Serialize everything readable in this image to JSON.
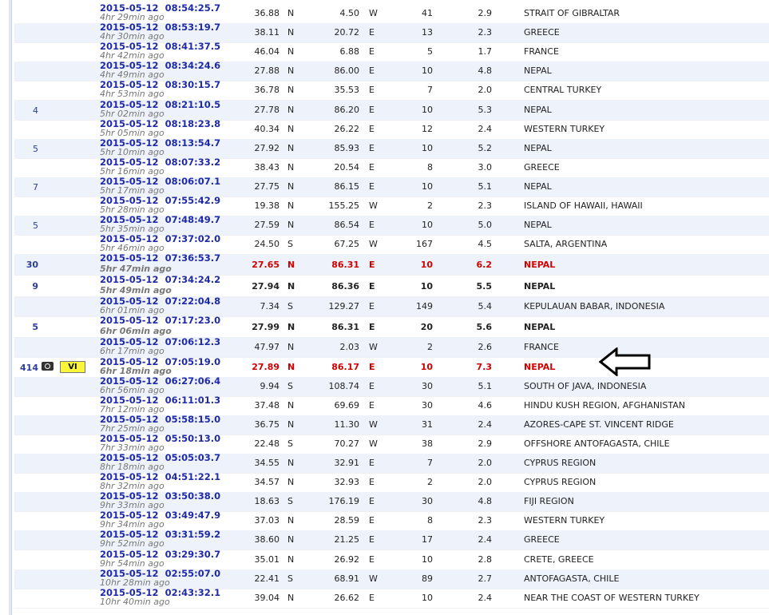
{
  "rows": [
    {
      "felt": "",
      "date": "2015-05-12",
      "time": "08:54:25.7",
      "ago": "4hr 29min ago",
      "lat": "36.88",
      "ns": "N",
      "lon": "4.50",
      "ew": "W",
      "depth": "41",
      "mag": "2.9",
      "region": "STRAIT OF GIBRALTAR",
      "style": ""
    },
    {
      "felt": "",
      "date": "2015-05-12",
      "time": "08:53:19.7",
      "ago": "4hr 30min ago",
      "lat": "38.11",
      "ns": "N",
      "lon": "20.72",
      "ew": "E",
      "depth": "13",
      "mag": "2.3",
      "region": "GREECE",
      "style": ""
    },
    {
      "felt": "",
      "date": "2015-05-12",
      "time": "08:41:37.5",
      "ago": "4hr 42min ago",
      "lat": "46.04",
      "ns": "N",
      "lon": "6.88",
      "ew": "E",
      "depth": "5",
      "mag": "1.7",
      "region": "FRANCE",
      "style": ""
    },
    {
      "felt": "",
      "date": "2015-05-12",
      "time": "08:34:24.6",
      "ago": "4hr 49min ago",
      "lat": "27.88",
      "ns": "N",
      "lon": "86.00",
      "ew": "E",
      "depth": "10",
      "mag": "4.8",
      "region": "NEPAL",
      "style": ""
    },
    {
      "felt": "",
      "date": "2015-05-12",
      "time": "08:30:15.7",
      "ago": "4hr 53min ago",
      "lat": "36.78",
      "ns": "N",
      "lon": "35.53",
      "ew": "E",
      "depth": "7",
      "mag": "2.0",
      "region": "CENTRAL TURKEY",
      "style": ""
    },
    {
      "felt": "4",
      "date": "2015-05-12",
      "time": "08:21:10.5",
      "ago": "5hr 02min ago",
      "lat": "27.78",
      "ns": "N",
      "lon": "86.20",
      "ew": "E",
      "depth": "10",
      "mag": "5.3",
      "region": "NEPAL",
      "style": ""
    },
    {
      "felt": "",
      "date": "2015-05-12",
      "time": "08:18:23.8",
      "ago": "5hr 05min ago",
      "lat": "40.34",
      "ns": "N",
      "lon": "26.22",
      "ew": "E",
      "depth": "12",
      "mag": "2.4",
      "region": "WESTERN TURKEY",
      "style": ""
    },
    {
      "felt": "5",
      "date": "2015-05-12",
      "time": "08:13:54.7",
      "ago": "5hr 10min ago",
      "lat": "27.92",
      "ns": "N",
      "lon": "85.93",
      "ew": "E",
      "depth": "10",
      "mag": "5.2",
      "region": "NEPAL",
      "style": ""
    },
    {
      "felt": "",
      "date": "2015-05-12",
      "time": "08:07:33.2",
      "ago": "5hr 16min ago",
      "lat": "38.43",
      "ns": "N",
      "lon": "20.54",
      "ew": "E",
      "depth": "8",
      "mag": "3.0",
      "region": "GREECE",
      "style": ""
    },
    {
      "felt": "7",
      "date": "2015-05-12",
      "time": "08:06:07.1",
      "ago": "5hr 17min ago",
      "lat": "27.75",
      "ns": "N",
      "lon": "86.15",
      "ew": "E",
      "depth": "10",
      "mag": "5.1",
      "region": "NEPAL",
      "style": ""
    },
    {
      "felt": "",
      "date": "2015-05-12",
      "time": "07:55:42.9",
      "ago": "5hr 28min ago",
      "lat": "19.38",
      "ns": "N",
      "lon": "155.25",
      "ew": "W",
      "depth": "2",
      "mag": "2.3",
      "region": "ISLAND OF HAWAII, HAWAII",
      "style": ""
    },
    {
      "felt": "5",
      "date": "2015-05-12",
      "time": "07:48:49.7",
      "ago": "5hr 35min ago",
      "lat": "27.59",
      "ns": "N",
      "lon": "86.54",
      "ew": "E",
      "depth": "10",
      "mag": "5.0",
      "region": "NEPAL",
      "style": ""
    },
    {
      "felt": "",
      "date": "2015-05-12",
      "time": "07:37:02.0",
      "ago": "5hr 46min ago",
      "lat": "24.50",
      "ns": "S",
      "lon": "67.25",
      "ew": "W",
      "depth": "167",
      "mag": "4.5",
      "region": "SALTA, ARGENTINA",
      "style": ""
    },
    {
      "felt": "30",
      "date": "2015-05-12",
      "time": "07:36:53.7",
      "ago": "5hr 47min ago",
      "lat": "27.65",
      "ns": "N",
      "lon": "86.31",
      "ew": "E",
      "depth": "10",
      "mag": "6.2",
      "region": "NEPAL",
      "style": "hl"
    },
    {
      "felt": "9",
      "date": "2015-05-12",
      "time": "07:34:24.2",
      "ago": "5hr 49min ago",
      "lat": "27.94",
      "ns": "N",
      "lon": "86.36",
      "ew": "E",
      "depth": "10",
      "mag": "5.5",
      "region": "NEPAL",
      "style": "bold"
    },
    {
      "felt": "",
      "date": "2015-05-12",
      "time": "07:22:04.8",
      "ago": "6hr 01min ago",
      "lat": "7.34",
      "ns": "S",
      "lon": "129.27",
      "ew": "E",
      "depth": "149",
      "mag": "5.4",
      "region": "KEPULAUAN BABAR, INDONESIA",
      "style": ""
    },
    {
      "felt": "5",
      "date": "2015-05-12",
      "time": "07:17:23.0",
      "ago": "6hr 06min ago",
      "lat": "27.99",
      "ns": "N",
      "lon": "86.31",
      "ew": "E",
      "depth": "20",
      "mag": "5.6",
      "region": "NEPAL",
      "style": "bold"
    },
    {
      "felt": "",
      "date": "2015-05-12",
      "time": "07:06:12.3",
      "ago": "6hr 17min ago",
      "lat": "47.97",
      "ns": "N",
      "lon": "2.03",
      "ew": "W",
      "depth": "2",
      "mag": "2.6",
      "region": "FRANCE",
      "style": ""
    },
    {
      "felt": "414",
      "date": "2015-05-12",
      "time": "07:05:19.0",
      "ago": "6hr 18min ago",
      "lat": "27.89",
      "ns": "N",
      "lon": "86.17",
      "ew": "E",
      "depth": "10",
      "mag": "7.3",
      "region": "NEPAL",
      "style": "hl",
      "intensity": "VI"
    },
    {
      "felt": "",
      "date": "2015-05-12",
      "time": "06:27:06.4",
      "ago": "6hr 56min ago",
      "lat": "9.94",
      "ns": "S",
      "lon": "108.74",
      "ew": "E",
      "depth": "30",
      "mag": "5.1",
      "region": "SOUTH OF JAVA, INDONESIA",
      "style": ""
    },
    {
      "felt": "",
      "date": "2015-05-12",
      "time": "06:11:01.3",
      "ago": "7hr 12min ago",
      "lat": "37.48",
      "ns": "N",
      "lon": "69.69",
      "ew": "E",
      "depth": "30",
      "mag": "4.6",
      "region": "HINDU KUSH REGION, AFGHANISTAN",
      "style": ""
    },
    {
      "felt": "",
      "date": "2015-05-12",
      "time": "05:58:15.0",
      "ago": "7hr 25min ago",
      "lat": "36.75",
      "ns": "N",
      "lon": "11.30",
      "ew": "W",
      "depth": "31",
      "mag": "2.4",
      "region": "AZORES-CAPE ST. VINCENT RIDGE",
      "style": ""
    },
    {
      "felt": "",
      "date": "2015-05-12",
      "time": "05:50:13.0",
      "ago": "7hr 33min ago",
      "lat": "22.48",
      "ns": "S",
      "lon": "70.27",
      "ew": "W",
      "depth": "38",
      "mag": "2.9",
      "region": "OFFSHORE ANTOFAGASTA, CHILE",
      "style": ""
    },
    {
      "felt": "",
      "date": "2015-05-12",
      "time": "05:05:03.7",
      "ago": "8hr 18min ago",
      "lat": "34.55",
      "ns": "N",
      "lon": "32.91",
      "ew": "E",
      "depth": "7",
      "mag": "2.0",
      "region": "CYPRUS REGION",
      "style": ""
    },
    {
      "felt": "",
      "date": "2015-05-12",
      "time": "04:51:22.1",
      "ago": "8hr 32min ago",
      "lat": "34.57",
      "ns": "N",
      "lon": "32.93",
      "ew": "E",
      "depth": "2",
      "mag": "2.0",
      "region": "CYPRUS REGION",
      "style": ""
    },
    {
      "felt": "",
      "date": "2015-05-12",
      "time": "03:50:38.0",
      "ago": "9hr 33min ago",
      "lat": "18.63",
      "ns": "S",
      "lon": "176.19",
      "ew": "E",
      "depth": "30",
      "mag": "4.8",
      "region": "FIJI REGION",
      "style": ""
    },
    {
      "felt": "",
      "date": "2015-05-12",
      "time": "03:49:47.9",
      "ago": "9hr 34min ago",
      "lat": "37.03",
      "ns": "N",
      "lon": "28.59",
      "ew": "E",
      "depth": "8",
      "mag": "2.3",
      "region": "WESTERN TURKEY",
      "style": ""
    },
    {
      "felt": "",
      "date": "2015-05-12",
      "time": "03:31:59.2",
      "ago": "9hr 52min ago",
      "lat": "38.60",
      "ns": "N",
      "lon": "21.25",
      "ew": "E",
      "depth": "17",
      "mag": "2.4",
      "region": "GREECE",
      "style": ""
    },
    {
      "felt": "",
      "date": "2015-05-12",
      "time": "03:29:30.7",
      "ago": "9hr 54min ago",
      "lat": "35.01",
      "ns": "N",
      "lon": "26.92",
      "ew": "E",
      "depth": "10",
      "mag": "2.8",
      "region": "CRETE, GREECE",
      "style": ""
    },
    {
      "felt": "",
      "date": "2015-05-12",
      "time": "02:55:07.0",
      "ago": "10hr 28min ago",
      "lat": "22.41",
      "ns": "S",
      "lon": "68.91",
      "ew": "W",
      "depth": "89",
      "mag": "2.7",
      "region": "ANTOFAGASTA, CHILE",
      "style": ""
    },
    {
      "felt": "",
      "date": "2015-05-12",
      "time": "02:43:32.1",
      "ago": "10hr 40min ago",
      "lat": "39.04",
      "ns": "N",
      "lon": "26.62",
      "ew": "E",
      "depth": "10",
      "mag": "2.4",
      "region": "NEAR THE COAST OF WESTERN TURKEY",
      "style": ""
    }
  ],
  "icons": {
    "camera": "camera-icon",
    "arrow": "arrow-left-icon"
  },
  "colors": {
    "datetime": "#1f2aa8",
    "highlight": "#d10000",
    "shade": "#eef3fb",
    "intensity_bg": "#f8f53a"
  }
}
